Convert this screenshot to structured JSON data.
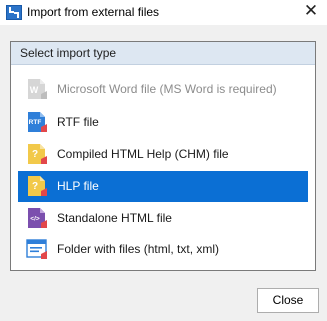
{
  "window": {
    "title": "Import from external files",
    "app_icon": "import-app-icon",
    "close_glyph": "✕"
  },
  "list": {
    "header": "Select import type",
    "items": [
      {
        "label": "Microsoft Word file (MS Word is required)",
        "icon": "word-file-icon",
        "icon_text": "W",
        "color": "#c8c8c8",
        "enabled": false,
        "selected": false
      },
      {
        "label": "RTF file",
        "icon": "rtf-file-icon",
        "icon_text": "RTF",
        "color": "#2f7fd9",
        "enabled": true,
        "selected": false
      },
      {
        "label": "Compiled HTML Help (CHM) file",
        "icon": "chm-file-icon",
        "icon_text": "?",
        "color": "#f2c94a",
        "enabled": true,
        "selected": false
      },
      {
        "label": "HLP file",
        "icon": "hlp-file-icon",
        "icon_text": "?",
        "color": "#f2c94a",
        "enabled": true,
        "selected": true
      },
      {
        "label": "Standalone HTML file",
        "icon": "html-file-icon",
        "icon_text": "</>",
        "color": "#7b4fae",
        "enabled": true,
        "selected": false
      },
      {
        "label": "Folder with files (html, txt, xml)",
        "icon": "folder-files-icon",
        "icon_text": "",
        "color": "#2f7fd9",
        "enabled": true,
        "selected": false
      }
    ]
  },
  "footer": {
    "close_label": "Close"
  },
  "colors": {
    "selection": "#0b6fd4",
    "header_bg": "#dde7f2",
    "arrow_badge": "#e2474b"
  }
}
